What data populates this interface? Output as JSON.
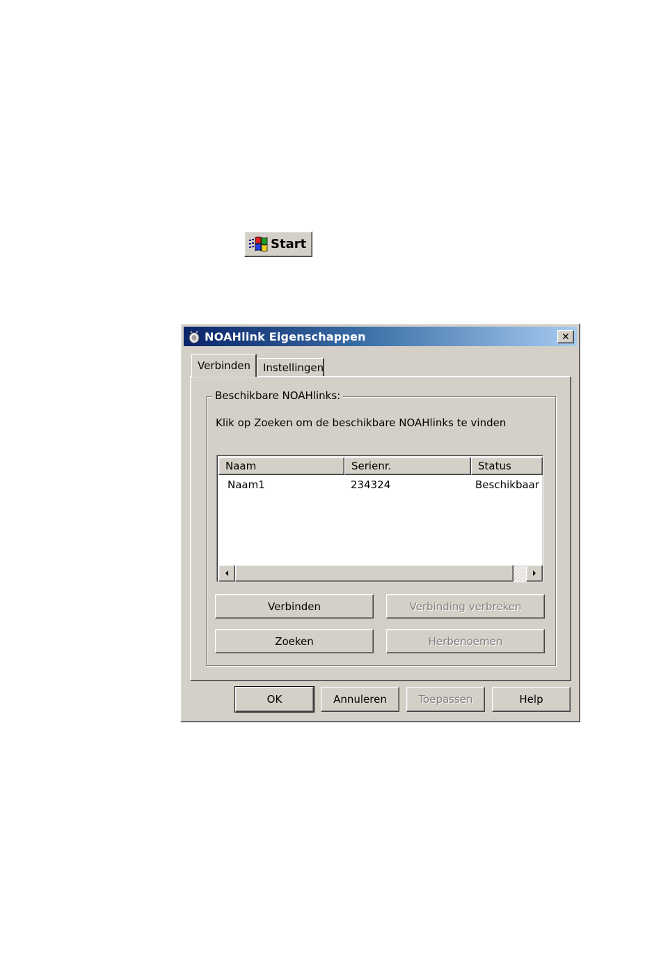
{
  "start": {
    "label": "Start"
  },
  "dialog": {
    "title": "NOAHlink Eigenschappen",
    "close_symbol": "✕"
  },
  "tabs": [
    {
      "label": "Verbinden",
      "selected": true
    },
    {
      "label": "Instellingen",
      "selected": false
    }
  ],
  "group": {
    "label": "Beschikbare NOAHlinks:",
    "instruction": "Klik op Zoeken om de beschikbare NOAHlinks te vinden"
  },
  "list": {
    "columns": [
      "Naam",
      "Serienr.",
      "Status"
    ],
    "rows": [
      {
        "naam": "Naam1",
        "serienr": "234324",
        "status": "Beschikbaar"
      }
    ]
  },
  "actions": {
    "verbinden": "Verbinden",
    "verbreken": "Verbinding verbreken",
    "zoeken": "Zoeken",
    "herbenoemen": "Herbenoemen"
  },
  "footer": {
    "ok": "OK",
    "annuleren": "Annuleren",
    "toepassen": "Toepassen",
    "help": "Help"
  },
  "colors": {
    "face": "#d4d0c8",
    "title_start": "#0a246a",
    "title_end": "#a6caf0",
    "disabled_text": "#808080"
  },
  "icons": [
    "windows-flag-icon",
    "noahlink-app-icon",
    "close-icon",
    "arrow-left-icon",
    "arrow-right-icon"
  ]
}
